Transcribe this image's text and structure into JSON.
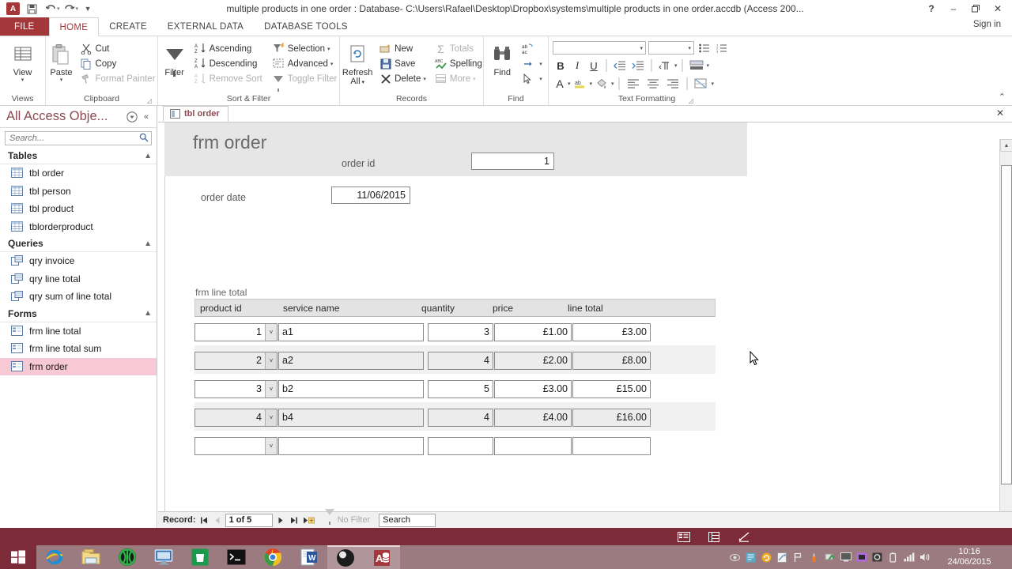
{
  "window": {
    "title": "multiple products in one order : Database- C:\\Users\\Rafael\\Desktop\\Dropbox\\systems\\multiple products in one order.accdb (Access 200...",
    "help_label": "?",
    "minimize_label": "–",
    "restore_label": "❐",
    "close_label": "✕",
    "signin_label": "Sign in",
    "app_icon": "access-logo-icon",
    "quick_access": [
      {
        "name": "save-icon",
        "label": "💾"
      },
      {
        "name": "undo-icon",
        "label": "↶"
      },
      {
        "name": "redo-icon",
        "label": "↷"
      },
      {
        "name": "customize-qat-icon",
        "label": "▾"
      }
    ]
  },
  "ribbon": {
    "tabs": [
      {
        "label": "FILE",
        "active": false
      },
      {
        "label": "HOME",
        "active": true
      },
      {
        "label": "CREATE",
        "active": false
      },
      {
        "label": "EXTERNAL DATA",
        "active": false
      },
      {
        "label": "DATABASE TOOLS",
        "active": false
      }
    ],
    "groups": {
      "views": {
        "label": "Views",
        "view_button": "View",
        "view_caret": "▾"
      },
      "clipboard": {
        "label": "Clipboard",
        "paste": "Paste",
        "paste_caret": "▾",
        "cut": "Cut",
        "copy": "Copy",
        "format_painter": "Format Painter",
        "dialog_launcher": "⤵"
      },
      "sort_filter": {
        "label": "Sort & Filter",
        "filter": "Filter",
        "ascending": "Ascending",
        "descending": "Descending",
        "remove_sort": "Remove Sort",
        "selection": "Selection",
        "advanced": "Advanced",
        "toggle_filter": "Toggle Filter"
      },
      "records": {
        "label": "Records",
        "refresh_all": "Refresh",
        "refresh_all_2": "All",
        "new": "New",
        "save": "Save",
        "delete": "Delete",
        "totals": "Totals",
        "spelling": "Spelling",
        "more": "More"
      },
      "find": {
        "label": "Find",
        "find": "Find",
        "replace": "ab⁄ac",
        "goto": "→",
        "select": "↱"
      },
      "text_formatting": {
        "label": "Text Formatting",
        "bold": "B",
        "italic": "I",
        "underline": "U",
        "font_color": "A",
        "highlight": "ab",
        "fill_color": "◆",
        "dialog_launcher": "⤵",
        "collapse_ribbon": "⌃"
      }
    }
  },
  "navpane": {
    "title": "All Access Obje...",
    "menu_icon": "▼",
    "collapse_icon": "«",
    "search_placeholder": "Search...",
    "search_value": "",
    "groups": [
      {
        "label": "Tables",
        "chevron": "«",
        "items": [
          {
            "label": "tbl order",
            "icon": "table-icon",
            "selected": false
          },
          {
            "label": "tbl person",
            "icon": "table-icon",
            "selected": false
          },
          {
            "label": "tbl product",
            "icon": "table-icon",
            "selected": false
          },
          {
            "label": "tblorderproduct",
            "icon": "table-icon",
            "selected": false
          }
        ]
      },
      {
        "label": "Queries",
        "chevron": "«",
        "items": [
          {
            "label": "qry invoice",
            "icon": "query-icon",
            "selected": false
          },
          {
            "label": "qry line total",
            "icon": "query-icon",
            "selected": false
          },
          {
            "label": "qry sum of line total",
            "icon": "query-icon",
            "selected": false
          }
        ]
      },
      {
        "label": "Forms",
        "chevron": "«",
        "items": [
          {
            "label": "frm line total",
            "icon": "form-icon",
            "selected": false
          },
          {
            "label": "frm line total sum",
            "icon": "form-icon",
            "selected": false
          },
          {
            "label": "frm order",
            "icon": "form-icon",
            "selected": true
          }
        ]
      }
    ]
  },
  "document": {
    "tab_label": "tbl order",
    "close_label": "✕",
    "form_title": "frm order",
    "header_field": {
      "label": "order id",
      "value": "1"
    },
    "detail_field": {
      "label": "order date",
      "value": "11/06/2015"
    },
    "subform": {
      "label": "frm line total",
      "columns": [
        "product id",
        "service name",
        "quantity",
        "price",
        "line total"
      ],
      "rows": [
        {
          "product_id": "1",
          "service_name": "a1",
          "quantity": "3",
          "price": "£1.00",
          "line_total": "£3.00"
        },
        {
          "product_id": "2",
          "service_name": "a2",
          "quantity": "4",
          "price": "£2.00",
          "line_total": "£8.00"
        },
        {
          "product_id": "3",
          "service_name": "b2",
          "quantity": "5",
          "price": "£3.00",
          "line_total": "£15.00"
        },
        {
          "product_id": "4",
          "service_name": "b4",
          "quantity": "4",
          "price": "£4.00",
          "line_total": "£16.00"
        },
        {
          "product_id": "",
          "service_name": "",
          "quantity": "",
          "price": "",
          "line_total": ""
        }
      ],
      "dropdown_caret": "˅"
    }
  },
  "record_nav": {
    "label": "Record:",
    "first": "⏮",
    "prev": "◀",
    "position": "1 of 5",
    "next": "▶",
    "last": "⏭",
    "new_record": "▶✳",
    "filter_status": "No Filter",
    "search_placeholder": "Search",
    "search_value": "Search"
  },
  "statusbar": {
    "view_icons": [
      "form-view-icon",
      "datasheet-view-icon",
      "design-view-icon"
    ]
  },
  "taskbar": {
    "start_icon": "windows-start-icon",
    "apps": [
      {
        "name": "internet-explorer-icon",
        "active": false
      },
      {
        "name": "file-explorer-icon",
        "active": false
      },
      {
        "name": "media-player-icon",
        "active": false
      },
      {
        "name": "display-settings-icon",
        "active": false
      },
      {
        "name": "windows-store-icon",
        "active": false
      },
      {
        "name": "command-prompt-icon",
        "active": false
      },
      {
        "name": "google-chrome-icon",
        "active": false
      },
      {
        "name": "microsoft-word-icon",
        "active": false
      },
      {
        "name": "obs-studio-icon",
        "active": true
      },
      {
        "name": "microsoft-access-icon",
        "active": true
      }
    ],
    "clock_time": "10:16",
    "clock_date": "24/06/2015"
  }
}
